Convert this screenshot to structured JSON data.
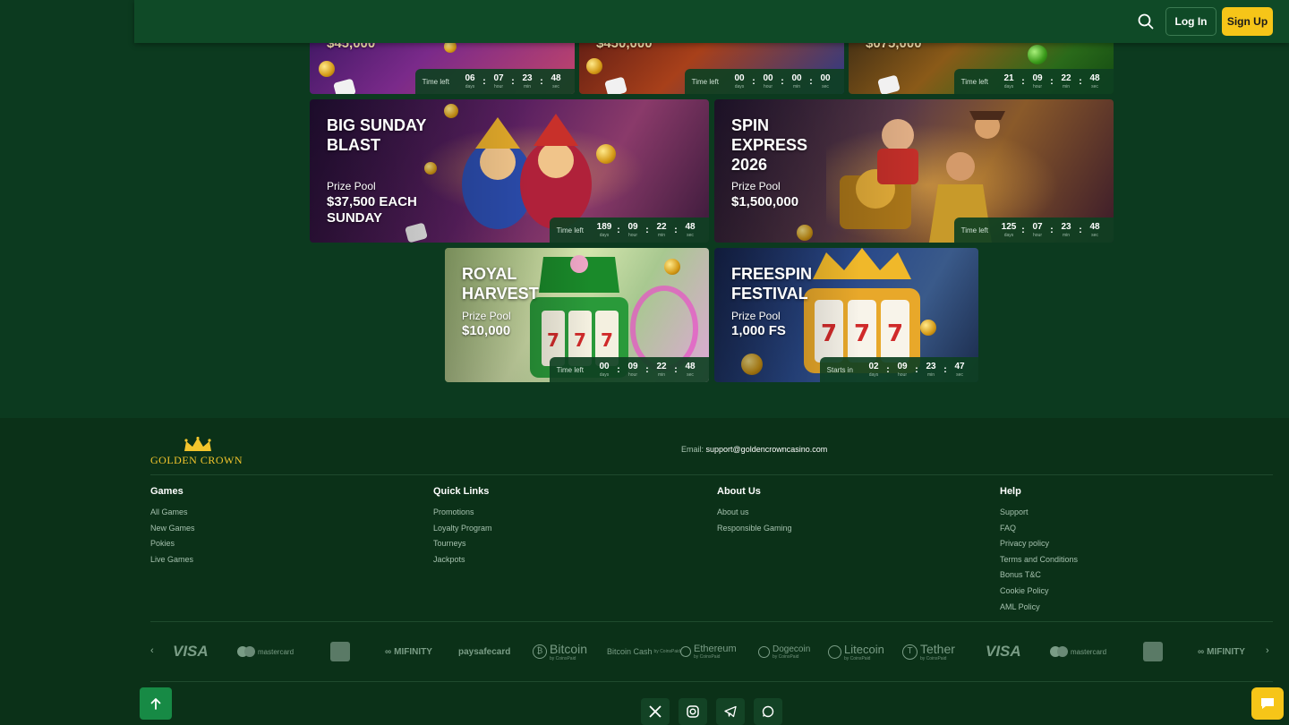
{
  "header": {
    "login_label": "Log In",
    "signup_label": "Sign Up"
  },
  "top_row": [
    {
      "prize": "$45,000",
      "timer_label": "Time left",
      "days": "06",
      "hours": "07",
      "min": "23",
      "sec": "48"
    },
    {
      "prize": "$450,000",
      "timer_label": "Time left",
      "days": "00",
      "hours": "00",
      "min": "00",
      "sec": "00"
    },
    {
      "prize": "$075,000",
      "timer_label": "Time left",
      "days": "21",
      "hours": "09",
      "min": "22",
      "sec": "48"
    }
  ],
  "cards": [
    {
      "title": "BIG SUNDAY BLAST",
      "pool_label": "Prize Pool",
      "pool_value": "$37,500 EACH SUNDAY",
      "timer_label": "Time left",
      "days": "189",
      "hours": "09",
      "min": "22",
      "sec": "48"
    },
    {
      "title": "SPIN EXPRESS 2026",
      "pool_label": "Prize Pool",
      "pool_value": "$1,500,000",
      "timer_label": "Time left",
      "days": "125",
      "hours": "07",
      "min": "23",
      "sec": "48"
    },
    {
      "title": "ROYAL HARVEST",
      "pool_label": "Prize Pool",
      "pool_value": "$10,000",
      "timer_label": "Time left",
      "days": "00",
      "hours": "09",
      "min": "22",
      "sec": "48"
    },
    {
      "title": "FREESPIN FESTIVAL",
      "pool_label": "Prize Pool",
      "pool_value": "1,000 FS",
      "timer_label": "Starts in",
      "days": "02",
      "hours": "09",
      "min": "23",
      "sec": "47"
    }
  ],
  "units": {
    "days": "days",
    "hour": "hour",
    "min": "min",
    "sec": "sec"
  },
  "footer": {
    "logo_text": "GOLDEN CROWN",
    "email_label": "Email:",
    "email": "support@goldencrowncasino.com",
    "columns": [
      {
        "heading": "Games",
        "links": [
          "All Games",
          "New Games",
          "Pokies",
          "Live Games"
        ]
      },
      {
        "heading": "Quick Links",
        "links": [
          "Promotions",
          "Loyalty Program",
          "Tourneys",
          "Jackpots"
        ]
      },
      {
        "heading": "About Us",
        "links": [
          "About us",
          "Responsible Gaming"
        ]
      },
      {
        "heading": "Help",
        "links": [
          "Support",
          "FAQ",
          "Privacy policy",
          "Terms and Conditions",
          "Bonus T&C",
          "Cookie Policy",
          "AML Policy"
        ]
      }
    ],
    "payments": [
      "VISA",
      "mastercard",
      "MIFINITY",
      "paysafecard",
      "Bitcoin",
      "Bitcoin Cash",
      "Ethereum",
      "Dogecoin",
      "Litecoin",
      "Tether",
      "VISA",
      "mastercard",
      "MIFINITY"
    ],
    "coinspaid_label": "by CoinsPaid"
  },
  "colors": {
    "background": "#0c3a1f",
    "header": "#0f4a27",
    "accent": "#f6c518",
    "footer": "#0b3118"
  }
}
